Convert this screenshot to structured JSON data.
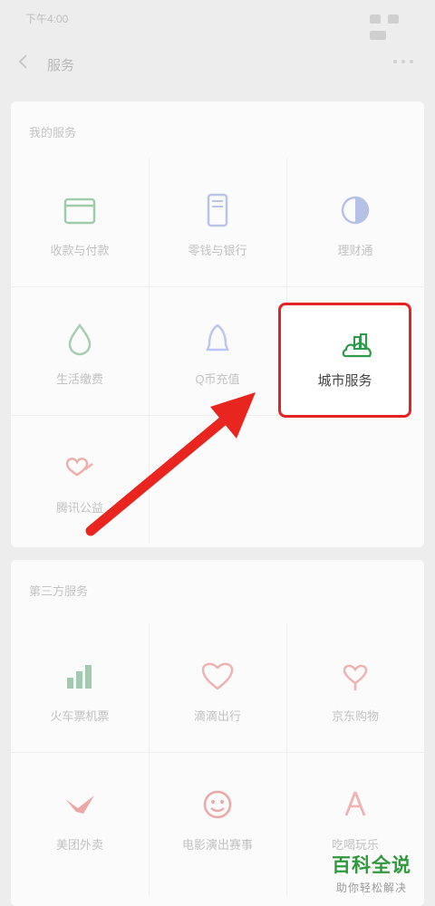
{
  "status_bar": {
    "time": "下午4:00"
  },
  "nav": {
    "title": "服务"
  },
  "section1": {
    "title": "我的服务",
    "items": [
      {
        "label": "收款与付款",
        "icon": "wallet-icon",
        "color": "#5aa869"
      },
      {
        "label": "零钱与银行",
        "icon": "phone-card-icon",
        "color": "#7f96d6"
      },
      {
        "label": "理财通",
        "icon": "moon-coin-icon",
        "color": "#6e86c7"
      },
      {
        "label": "生活缴费",
        "icon": "drop-icon",
        "color": "#6ea371"
      },
      {
        "label": "Q币充值",
        "icon": "bell-icon",
        "color": "#8896d8"
      },
      {
        "label": "城市服务",
        "icon": "city-icon",
        "color": "#2d9a4a"
      },
      {
        "label": "腾讯公益",
        "icon": "heart-hand-icon",
        "color": "#d9534f"
      }
    ]
  },
  "section2": {
    "title": "第三方服务",
    "items": [
      {
        "label": "火车票机票",
        "icon": "chart-icon",
        "color": "#3c8f5a"
      },
      {
        "label": "滴滴出行",
        "icon": "heart-icon",
        "color": "#e06666"
      },
      {
        "label": "京东购物",
        "icon": "heart-ribbon-icon",
        "color": "#e06666"
      },
      {
        "label": "美团外卖",
        "icon": "bird-icon",
        "color": "#d9534f"
      },
      {
        "label": "电影演出赛事",
        "icon": "face-icon",
        "color": "#d9534f"
      },
      {
        "label": "吃喝玩乐",
        "icon": "hand-icon",
        "color": "#e06666"
      }
    ]
  },
  "watermark": {
    "title": "百科全说",
    "subtitle": "助你轻松解决"
  }
}
